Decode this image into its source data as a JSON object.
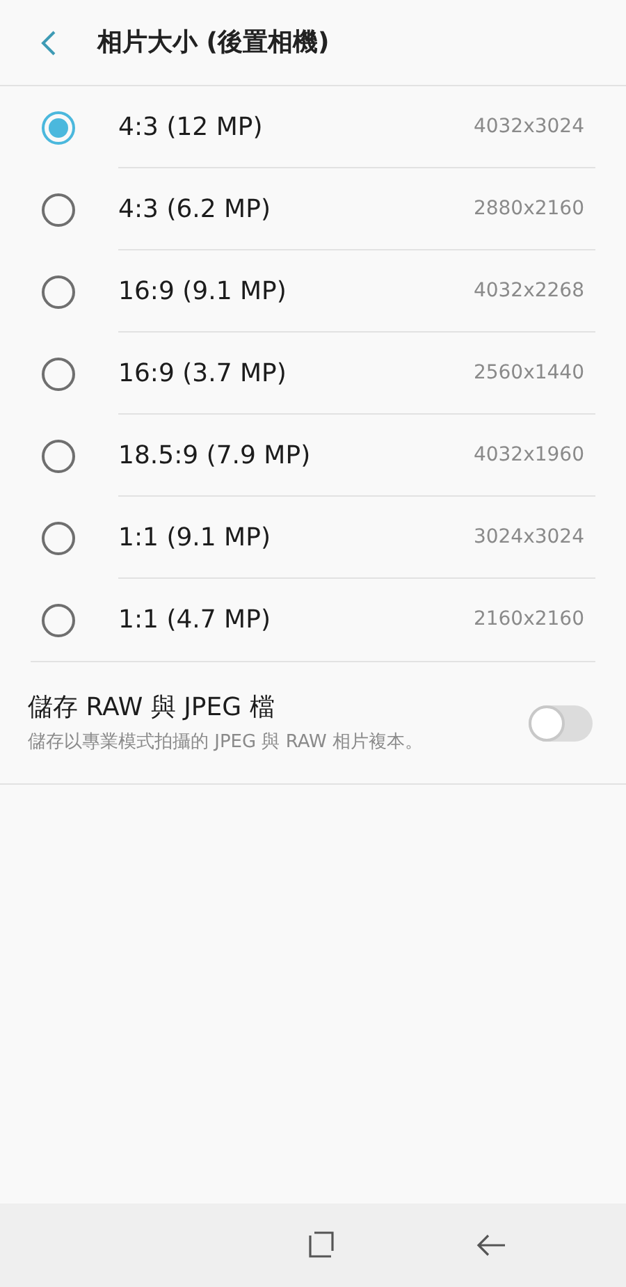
{
  "header": {
    "title": "相片大小 (後置相機)"
  },
  "options": [
    {
      "label": "4:3 (12 MP)",
      "resolution": "4032x3024",
      "selected": true
    },
    {
      "label": "4:3 (6.2 MP)",
      "resolution": "2880x2160",
      "selected": false
    },
    {
      "label": "16:9 (9.1 MP)",
      "resolution": "4032x2268",
      "selected": false
    },
    {
      "label": "16:9 (3.7 MP)",
      "resolution": "2560x1440",
      "selected": false
    },
    {
      "label": "18.5:9 (7.9 MP)",
      "resolution": "4032x1960",
      "selected": false
    },
    {
      "label": "1:1 (9.1 MP)",
      "resolution": "3024x3024",
      "selected": false
    },
    {
      "label": "1:1 (4.7 MP)",
      "resolution": "2160x2160",
      "selected": false
    }
  ],
  "raw_setting": {
    "title": "儲存 RAW 與 JPEG 檔",
    "description": "儲存以專業模式拍攝的 JPEG 與 RAW 相片複本。",
    "on": false
  }
}
